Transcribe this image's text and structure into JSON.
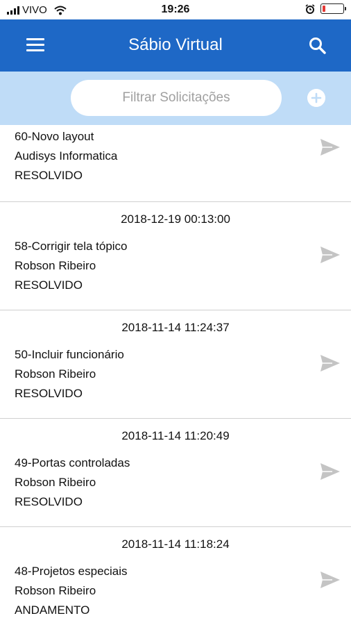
{
  "status_bar": {
    "carrier": "VIVO",
    "time": "19:26",
    "battery_level": 0.15,
    "battery_color": "#e53935"
  },
  "app_bar": {
    "title": "Sábio Virtual",
    "menu_icon": "hamburger-menu-icon",
    "search_icon": "search-icon",
    "background": "#1e68c6"
  },
  "filter": {
    "placeholder": "Filtrar Solicitações",
    "value": "",
    "add_icon": "plus-circle-icon",
    "background": "#bfdcf7"
  },
  "requests": [
    {
      "date": "",
      "title": "60-Novo layout",
      "owner": "Audisys Informatica",
      "status": "RESOLVIDO"
    },
    {
      "date": "2018-12-19 00:13:00",
      "title": "58-Corrigir tela tópico",
      "owner": "Robson Ribeiro",
      "status": "RESOLVIDO"
    },
    {
      "date": "2018-11-14 11:24:37",
      "title": "50-Incluir funcionário",
      "owner": "Robson Ribeiro",
      "status": "RESOLVIDO"
    },
    {
      "date": "2018-11-14 11:20:49",
      "title": "49-Portas controladas",
      "owner": "Robson Ribeiro",
      "status": "RESOLVIDO"
    },
    {
      "date": "2018-11-14 11:18:24",
      "title": "48-Projetos especiais",
      "owner": "Robson Ribeiro",
      "status": "ANDAMENTO"
    }
  ]
}
